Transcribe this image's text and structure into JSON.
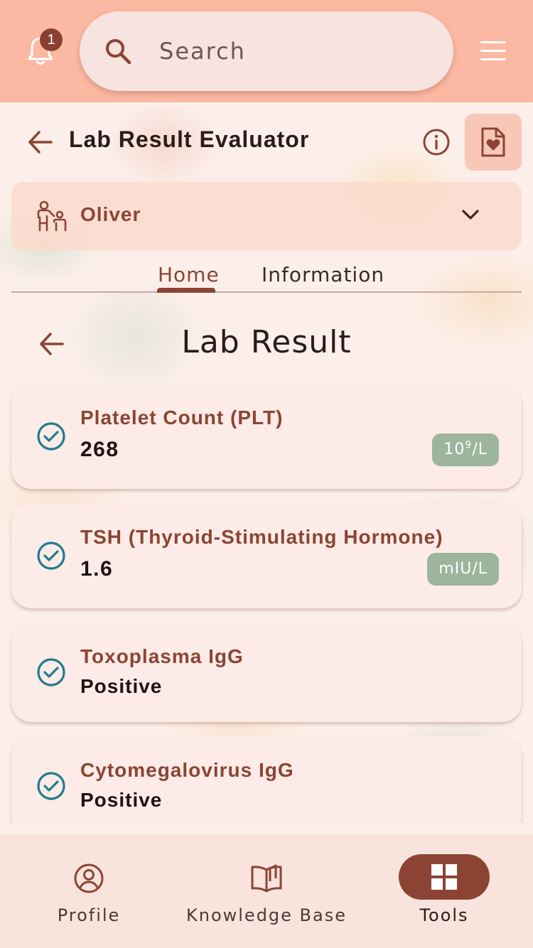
{
  "header": {
    "notification_count": "1",
    "search_placeholder": "Search"
  },
  "titlebar": {
    "title": "Lab Result Evaluator"
  },
  "patient": {
    "name": "Oliver"
  },
  "tabs": [
    {
      "label": "Home",
      "active": true
    },
    {
      "label": "Information",
      "active": false
    }
  ],
  "section": {
    "title": "Lab Result"
  },
  "results": [
    {
      "name": "Platelet Count (PLT)",
      "value": "268",
      "unit_base": "10",
      "unit_sup": "9",
      "unit_tail": "/L"
    },
    {
      "name": "TSH (Thyroid-Stimulating Hormone)",
      "value": "1.6",
      "unit": "mIU/L"
    },
    {
      "name": "Toxoplasma IgG",
      "value": "Positive"
    },
    {
      "name": "Cytomegalovirus IgG",
      "value": "Positive"
    }
  ],
  "bottom_nav": [
    {
      "label": "Profile",
      "icon": "profile-icon"
    },
    {
      "label": "Knowledge Base",
      "icon": "book-icon"
    },
    {
      "label": "Tools",
      "icon": "grid-icon",
      "active": true
    }
  ],
  "colors": {
    "header": "#fbb8a2",
    "accent": "#8b4434",
    "unit_badge": "#9cb59c",
    "check": "#1f7b8e"
  }
}
